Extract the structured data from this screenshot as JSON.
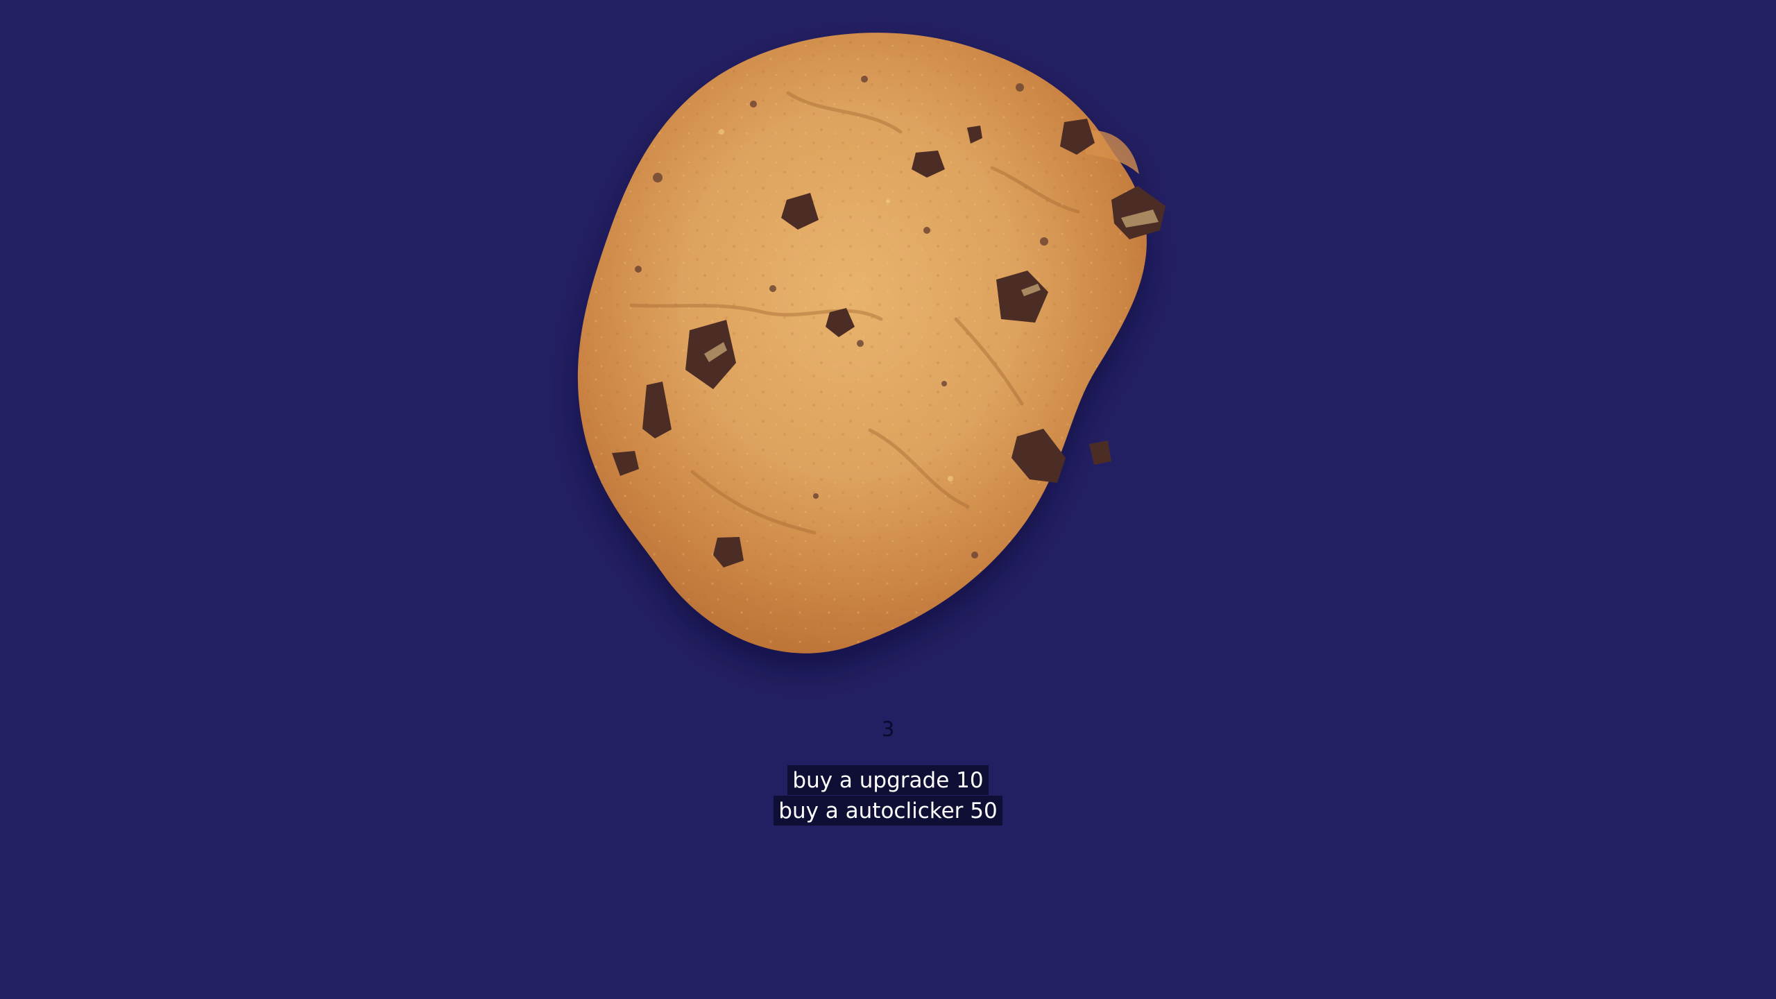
{
  "game": {
    "cookie_count": "3",
    "cookie_icon": "chocolate-chip-cookie-icon",
    "background_color": "#231f63",
    "cookie_color": "#d89a51"
  },
  "shop": {
    "items": [
      {
        "label": "buy a upgrade 10"
      },
      {
        "label": "buy a autoclicker 50"
      }
    ]
  }
}
